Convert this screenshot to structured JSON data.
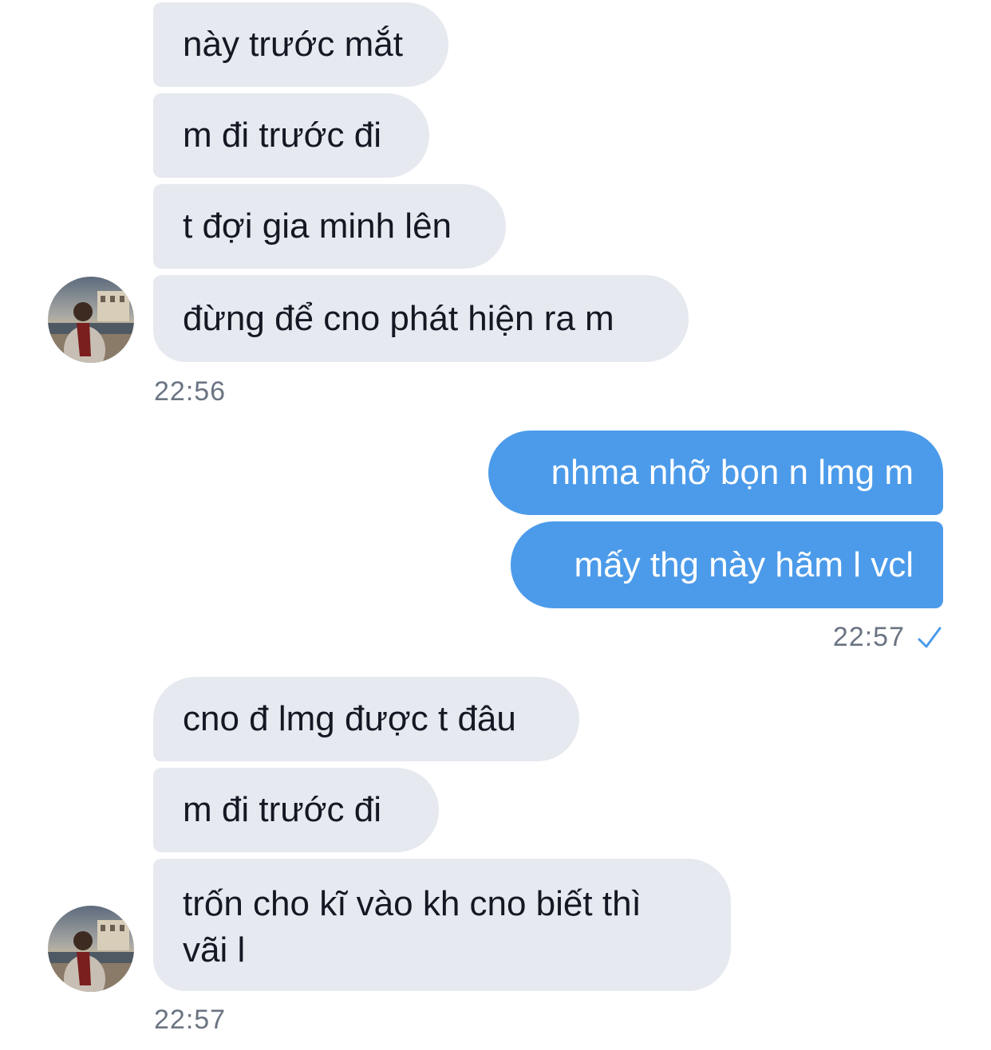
{
  "conversation": {
    "group1": {
      "messages": [
        "này trước mắt",
        "m đi trước đi",
        "t đợi gia minh lên",
        "đừng để cno phát hiện ra m"
      ],
      "time": "22:56",
      "avatar": "contact-avatar-photo"
    },
    "outgoing": {
      "messages": [
        "nhma nhỡ bọn n lmg m",
        "mấy thg này hãm l vcl"
      ],
      "time": "22:57",
      "status_icon": "checkmark-icon"
    },
    "group2": {
      "messages": [
        "cno đ lmg được t đâu",
        "m đi trước đi",
        "trốn cho kĩ vào kh cno biết thì\nvãi l"
      ],
      "time": "22:57",
      "avatar": "contact-avatar-photo"
    }
  },
  "colors": {
    "incoming_bubble": "#e6e9ef",
    "outgoing_bubble": "#4c9bea",
    "timestamp": "#6b7482",
    "check": "#4c9bea"
  }
}
